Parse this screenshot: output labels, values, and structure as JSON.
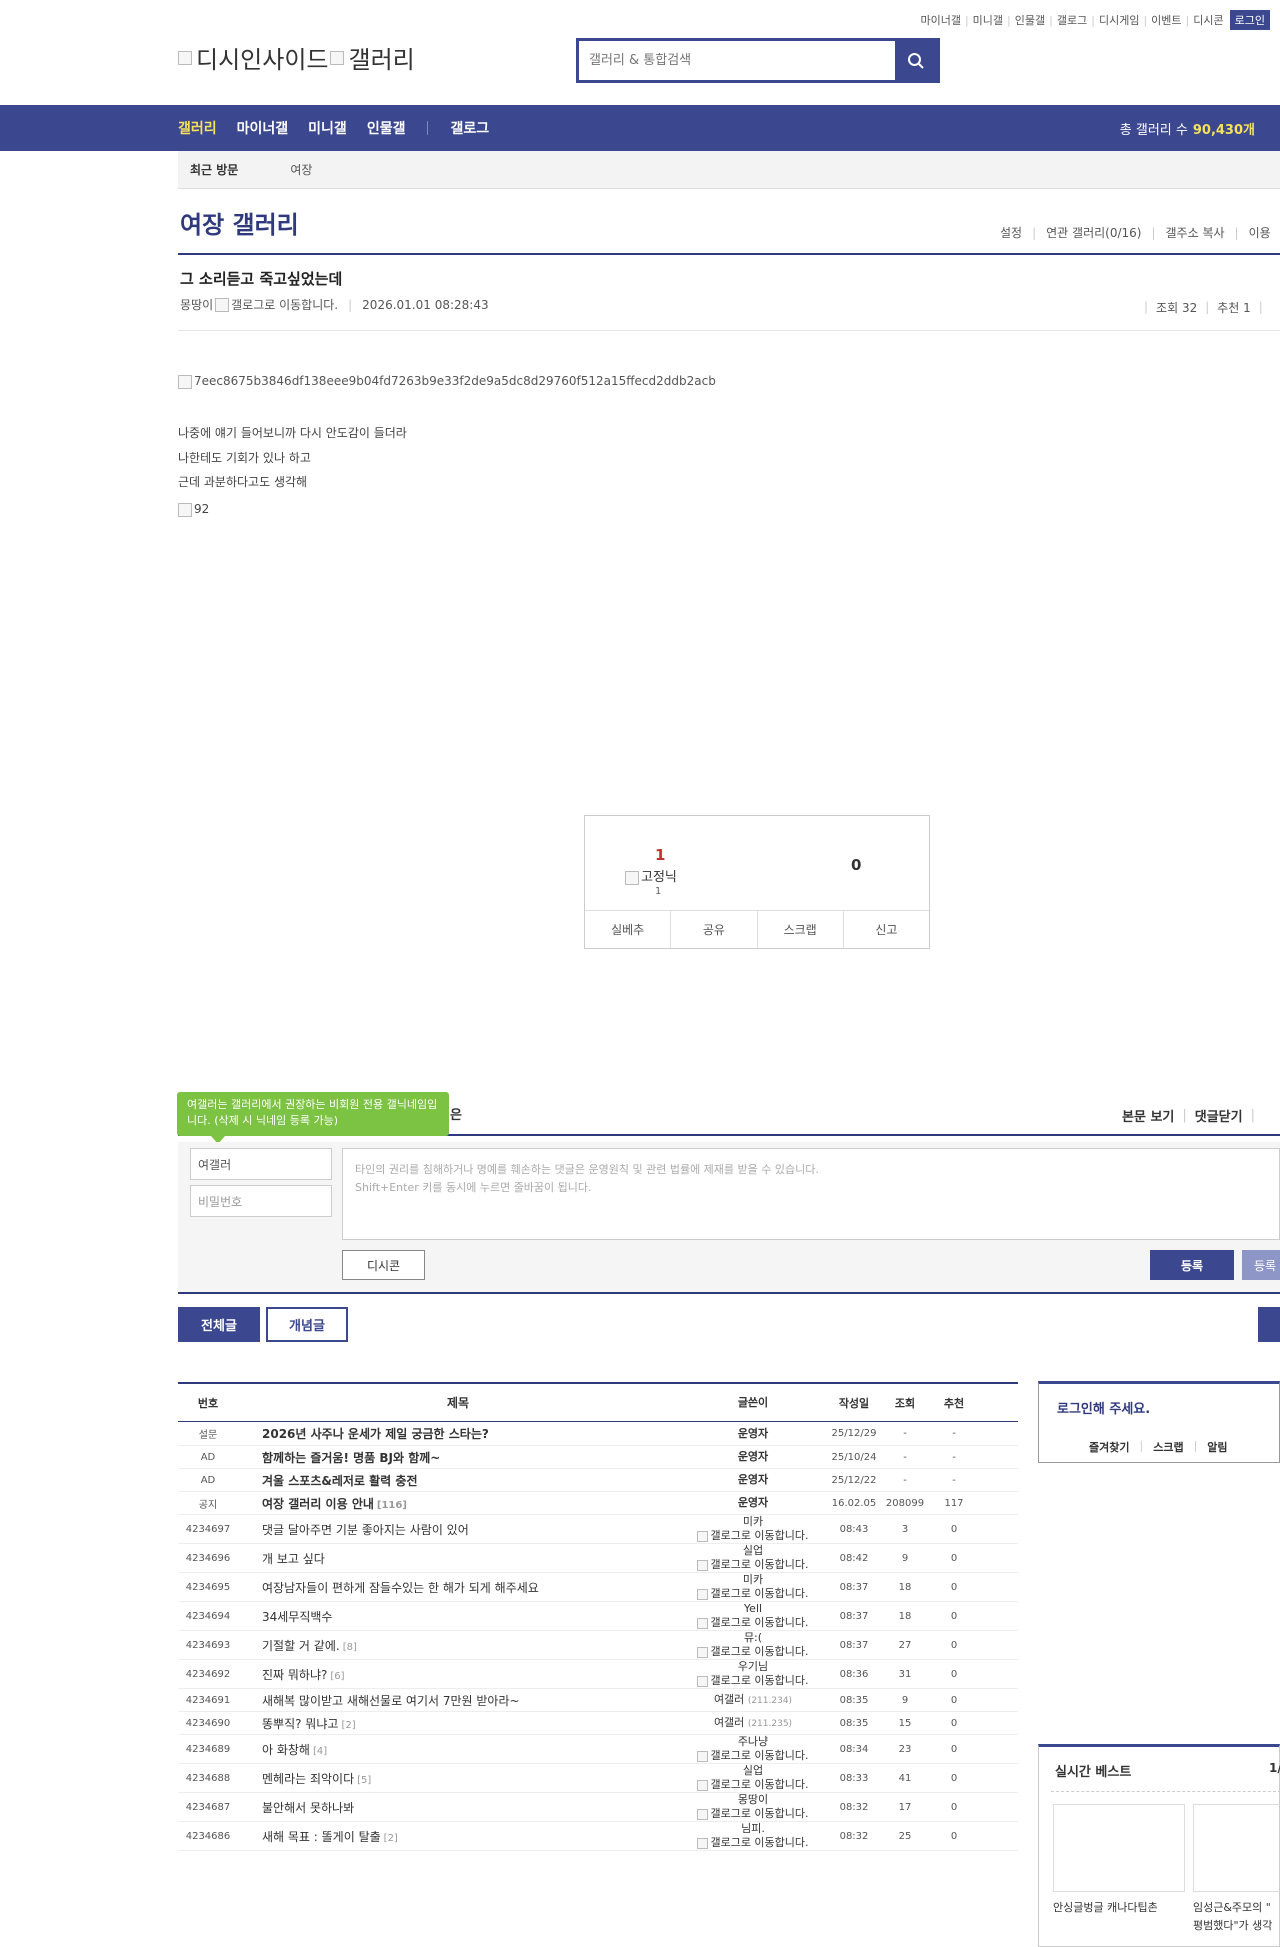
{
  "top_links": [
    "마이너갤",
    "미니갤",
    "인물갤",
    "갤로그",
    "디시게임",
    "이벤트",
    "디시콘"
  ],
  "login_label": "로그인",
  "logo": {
    "left": "디시인사이드",
    "right": "갤러리"
  },
  "search": {
    "placeholder": "갤러리 & 통합검색"
  },
  "nav": {
    "items": [
      "갤러리",
      "마이너갤",
      "미니갤",
      "인물갤",
      "갤로그"
    ],
    "total_label": "총 갤러리 수",
    "total_value": "90,430개"
  },
  "visit": {
    "label": "최근 방문",
    "item": "여장"
  },
  "gallery": {
    "title": "여장 갤러리",
    "tools": [
      "설정",
      "연관 갤러리(0/16)",
      "갤주소 복사",
      "이용"
    ]
  },
  "post": {
    "title": "그 소리듣고 죽고싶었는데",
    "author": "몽땅이",
    "author_img_alt": "갤로그로 이동합니다.",
    "datetime": "2026.01.01 08:28:43",
    "views": "조회 32",
    "recommends": "추천 1",
    "image1_alt": "7eec8675b3846df138eee9b04fd7263b9e33f2de9a5dc8d29760f512a15ffecd2ddb2acb",
    "lines": [
      "나중에 얘기 들어보니까 다시 안도감이 들더라",
      "나한테도 기회가 있나 하고",
      "근데 과분하다고도 생각해"
    ],
    "image2_alt": "92"
  },
  "recommend": {
    "up_count": "1",
    "up_img_alt": "고정닉",
    "up_sub": "1",
    "down_count": "0",
    "buttons": [
      "실베추",
      "공유",
      "스크랩",
      "신고"
    ]
  },
  "comment": {
    "tooltip": "여갤러는 갤러리에서 권장하는 비회원 전용 갤닉네임입니다. (삭제 시 닉네임 등록 가능)",
    "tooltip_tail": "은",
    "links": [
      "본문 보기",
      "댓글닫기"
    ],
    "name_value": "여갤러",
    "pw_placeholder": "비밀번호",
    "text_line1": "타인의 권리를 침해하거나 명예를 훼손하는 댓글은 운영원칙 및 관련 법률에 제재를 받을 수 있습니다.",
    "text_line2": "Shift+Enter 키를 동시에 누르면 줄바꿈이 됩니다.",
    "dccon": "디시콘",
    "register": "등록",
    "register2": "등록"
  },
  "tabs": {
    "all": "전체글",
    "concept": "개념글"
  },
  "table": {
    "headers": {
      "num": "번호",
      "title": "제목",
      "writer": "글쓴이",
      "date": "작성일",
      "views": "조회",
      "rec": "추천"
    },
    "gallog_alt": "갤로그로 이동합니다.",
    "rows": [
      {
        "num": "설문",
        "title": "2026년 사주나 운세가 제일 궁금한 스타는?",
        "cmt": "",
        "writer": "운영자",
        "ip": "",
        "gallog": false,
        "date": "25/12/29",
        "views": "-",
        "rec": "-",
        "bold": true
      },
      {
        "num": "AD",
        "title": "함께하는 즐거움! 명품 BJ와 함께~",
        "cmt": "",
        "writer": "운영자",
        "ip": "",
        "gallog": false,
        "date": "25/10/24",
        "views": "-",
        "rec": "-",
        "bold": true
      },
      {
        "num": "AD",
        "title": "겨울 스포츠&레저로 활력 충전",
        "cmt": "",
        "writer": "운영자",
        "ip": "",
        "gallog": false,
        "date": "25/12/22",
        "views": "-",
        "rec": "-",
        "bold": true
      },
      {
        "num": "공지",
        "title": "여장 갤러리 이용 안내",
        "cmt": "[116]",
        "writer": "운영자",
        "ip": "",
        "gallog": false,
        "date": "16.02.05",
        "views": "208099",
        "rec": "117",
        "bold": true
      },
      {
        "num": "4234697",
        "title": "댓글 달아주면 기분 좋아지는 사람이 있어",
        "cmt": "",
        "writer": "미카",
        "ip": "",
        "gallog": true,
        "date": "08:43",
        "views": "3",
        "rec": "0",
        "bold": false
      },
      {
        "num": "4234696",
        "title": "개 보고 싶다",
        "cmt": "",
        "writer": "실업",
        "ip": "",
        "gallog": true,
        "date": "08:42",
        "views": "9",
        "rec": "0",
        "bold": false
      },
      {
        "num": "4234695",
        "title": "여장남자들이 편하게 잠들수있는 한 해가 되게 해주세요",
        "cmt": "",
        "writer": "미카",
        "ip": "",
        "gallog": true,
        "date": "08:37",
        "views": "18",
        "rec": "0",
        "bold": false
      },
      {
        "num": "4234694",
        "title": "34세무직백수",
        "cmt": "",
        "writer": "Yell",
        "ip": "",
        "gallog": true,
        "date": "08:37",
        "views": "18",
        "rec": "0",
        "bold": false
      },
      {
        "num": "4234693",
        "title": "기절할 거 같에.",
        "cmt": "[8]",
        "writer": "뮤:(",
        "ip": "",
        "gallog": true,
        "date": "08:37",
        "views": "27",
        "rec": "0",
        "bold": false
      },
      {
        "num": "4234692",
        "title": "진짜 뭐하냐?",
        "cmt": "[6]",
        "writer": "우기님",
        "ip": "",
        "gallog": true,
        "date": "08:36",
        "views": "31",
        "rec": "0",
        "bold": false
      },
      {
        "num": "4234691",
        "title": "새해복 많이받고 새해선물로 여기서 7만원 받아라~",
        "cmt": "",
        "writer": "여갤러",
        "ip": "(211.234)",
        "gallog": false,
        "date": "08:35",
        "views": "9",
        "rec": "0",
        "bold": false
      },
      {
        "num": "4234690",
        "title": "똥뿌직? 뭐냐고",
        "cmt": "[2]",
        "writer": "여갤러",
        "ip": "(211.235)",
        "gallog": false,
        "date": "08:35",
        "views": "15",
        "rec": "0",
        "bold": false
      },
      {
        "num": "4234689",
        "title": "아 화창해",
        "cmt": "[4]",
        "writer": "주나냥",
        "ip": "",
        "gallog": true,
        "date": "08:34",
        "views": "23",
        "rec": "0",
        "bold": false
      },
      {
        "num": "4234688",
        "title": "멘헤라는 죄악이다",
        "cmt": "[5]",
        "writer": "실업",
        "ip": "",
        "gallog": true,
        "date": "08:33",
        "views": "41",
        "rec": "0",
        "bold": false
      },
      {
        "num": "4234687",
        "title": "불안해서 못하나봐",
        "cmt": "",
        "writer": "몽땅이",
        "ip": "",
        "gallog": true,
        "date": "08:32",
        "views": "17",
        "rec": "0",
        "bold": false
      },
      {
        "num": "4234686",
        "title": "새해 목표 : 똘게이 탈출",
        "cmt": "[2]",
        "writer": "님피.",
        "ip": "",
        "gallog": true,
        "date": "08:32",
        "views": "25",
        "rec": "0",
        "bold": false
      }
    ]
  },
  "side": {
    "login_title": "로그인해 주세요.",
    "login_links": [
      "즐겨찾기",
      "스크랩",
      "알림"
    ],
    "best_title": "실시간 베스트",
    "best_page": "1/",
    "best_cap1": "안싱글벙글 캐나다팁촌",
    "best_cap2_l1": "임성근&주모의 \"",
    "best_cap2_l2": "평범했다\"가 생각"
  }
}
